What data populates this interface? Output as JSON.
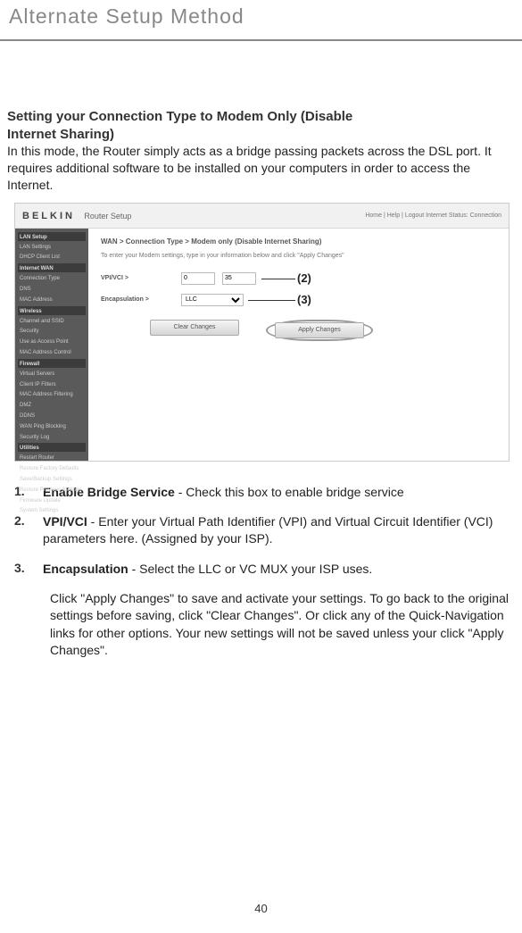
{
  "page": {
    "header_title": "Alternate Setup Method",
    "section_heading_line1": "Setting your Connection Type to Modem Only (Disable",
    "section_heading_line2": "Internet Sharing)",
    "intro_text": "In this mode, the Router simply acts as a bridge passing packets across the DSL port. It requires additional software to be installed on your computers in order to access the Internet.",
    "page_number": "40"
  },
  "screenshot": {
    "logo": "BELKIN",
    "logo_sub": "Router Setup",
    "topright": "Home | Help | Logout   Internet Status: Connection",
    "breadcrumb": "WAN > Connection Type > Modem only (Disable Internet Sharing)",
    "subtext": "To enter your Modem settings, type in your information below and click \"Apply Changes\"",
    "field1_label": "VPI/VCI >",
    "field1_val1": "0",
    "field1_val2": "35",
    "field2_label": "Encapsulation >",
    "field2_val": "LLC",
    "callout2": "(2)",
    "callout3": "(3)",
    "btn_clear": "Clear Changes",
    "btn_apply": "Apply Changes",
    "sidebar": {
      "section1": "LAN Setup",
      "items1": [
        "LAN Settings",
        "DHCP Client List"
      ],
      "section2": "Internet WAN",
      "items2": [
        "Connection Type",
        "DNS",
        "MAC Address"
      ],
      "section3": "Wireless",
      "items3": [
        "Channel and SSID",
        "Security",
        "Use as Access Point",
        "MAC Address Control"
      ],
      "section4": "Firewall",
      "items4": [
        "Virtual Servers",
        "Client IP Filters",
        "MAC Address Filtering",
        "DMZ",
        "DDNS",
        "WAN Ping Blocking",
        "Security Log"
      ],
      "section5": "Utilities",
      "items5": [
        "Restart Router",
        "Restore Factory Defaults",
        "Save/Backup Settings",
        "Restore Previous Settings",
        "Firmware Update",
        "System Settings"
      ]
    }
  },
  "list": {
    "item1_num": "1.",
    "item1_strong": "Enable Bridge Service",
    "item1_text": " - Check this box to enable bridge service",
    "item2_num": "2.",
    "item2_strong": "VPI/VCI",
    "item2_text": " - Enter your Virtual Path Identifier (VPI) and Virtual Circuit Identifier (VCI) parameters here. (Assigned by your ISP).",
    "item3_num": "3.",
    "item3_strong": "Encapsulation",
    "item3_text": " - Select the LLC or VC MUX your ISP uses.",
    "followup": "Click \"Apply Changes\" to save and activate your settings. To go back to the original settings before saving, click \"Clear Changes\". Or click any of the Quick-Navigation links for other options. Your new settings will not be saved unless your click \"Apply Changes\"."
  }
}
